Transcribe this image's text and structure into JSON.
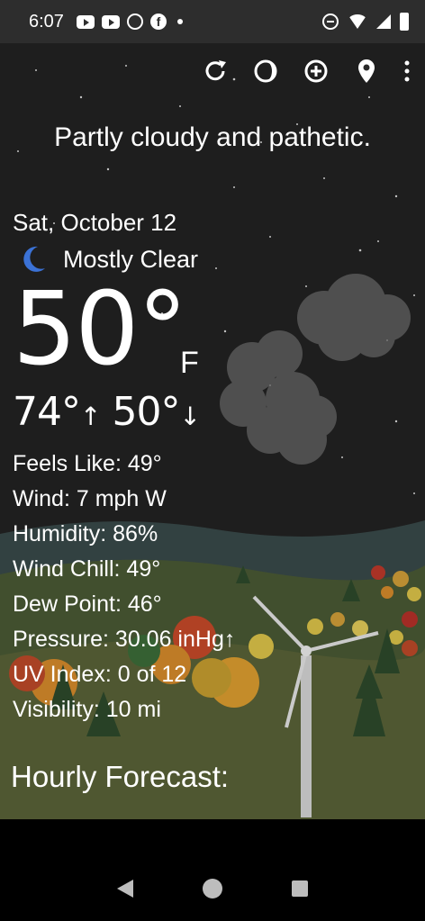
{
  "status_bar": {
    "time": "6:07",
    "icons_left": [
      "youtube-icon",
      "youtube-icon",
      "alarm-icon",
      "facebook-icon",
      "dot-icon"
    ],
    "icons_right": [
      "dnd-icon",
      "wifi-icon",
      "signal-icon",
      "battery-icon"
    ]
  },
  "toolbar": {
    "icons": [
      "refresh-icon",
      "theme-icon",
      "add-location-icon",
      "location-pin-icon",
      "more-vert-icon"
    ]
  },
  "tagline": "Partly cloudy and pathetic.",
  "weather": {
    "date": "Sat, October 12",
    "condition": "Mostly Clear",
    "condition_icon": "moon-icon",
    "temperature": "50°",
    "unit": "F",
    "high": "74°",
    "low": "50°",
    "up_arrow": "↑",
    "down_arrow": "↓"
  },
  "details": {
    "feels_like": "Feels Like:  49°",
    "wind": "Wind:  7 mph W",
    "humidity": "Humidity:  86%",
    "wind_chill": "Wind Chill:  49°",
    "dew_point": "Dew Point:  46°",
    "pressure": "Pressure:  30.06 inHg↑",
    "uv_index": "UV Index:  0 of 12",
    "visibility": "Visibility:  10 mi"
  },
  "hourly_heading": "Hourly Forecast:",
  "navigation": {
    "icons": [
      "back-icon",
      "home-icon",
      "recents-icon"
    ]
  },
  "colors": {
    "sky": "#232323",
    "status_bar": "#2d2d2d",
    "hills": "#3c4a2e",
    "moon": "#3b72d6"
  }
}
